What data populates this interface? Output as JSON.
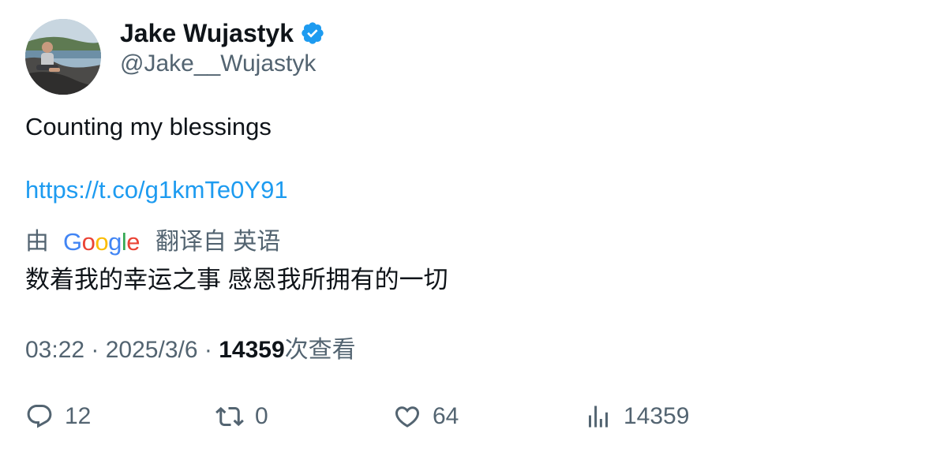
{
  "author": {
    "display_name": "Jake Wujastyk",
    "handle": "@Jake__Wujastyk",
    "verified": true,
    "verified_color": "#1d9bf0"
  },
  "tweet": {
    "text": "Counting my blessings",
    "link": "https://t.co/g1kmTe0Y91"
  },
  "translation": {
    "prefix": "由",
    "provider": "Google",
    "suffix": "翻译自 英语",
    "text": "数着我的幸运之事 感恩我所拥有的一切"
  },
  "meta": {
    "time": "03:22",
    "date": "2025/3/6",
    "views_count": "14359",
    "views_label": "次查看",
    "separator": " · "
  },
  "actions": {
    "replies": "12",
    "retweets": "0",
    "likes": "64",
    "views": "14359"
  },
  "colors": {
    "text": "#0f1419",
    "secondary": "#536471",
    "link": "#1d9bf0",
    "google_blue": "#4285f4",
    "google_red": "#ea4335",
    "google_yellow": "#fbbc05",
    "google_green": "#34a853"
  }
}
